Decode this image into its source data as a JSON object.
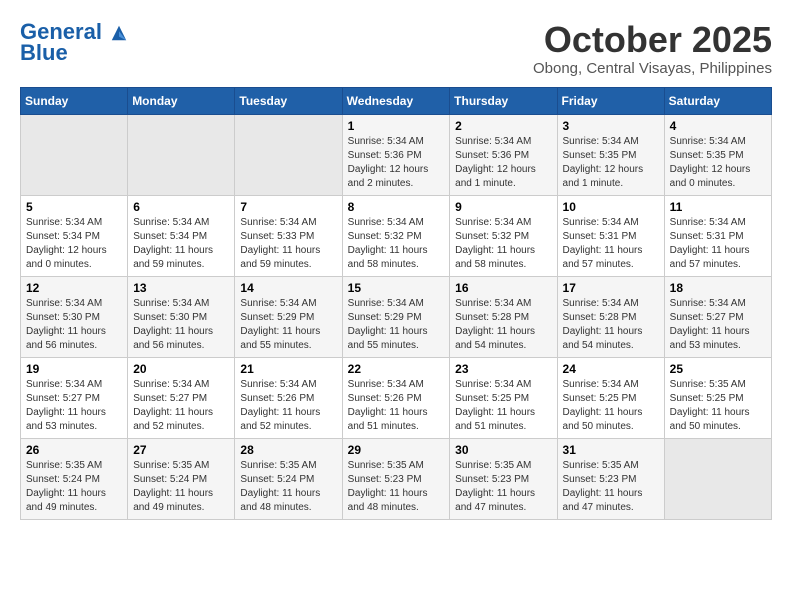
{
  "header": {
    "logo_line1": "General",
    "logo_line2": "Blue",
    "month": "October 2025",
    "location": "Obong, Central Visayas, Philippines"
  },
  "days_of_week": [
    "Sunday",
    "Monday",
    "Tuesday",
    "Wednesday",
    "Thursday",
    "Friday",
    "Saturday"
  ],
  "weeks": [
    [
      {
        "day": "",
        "info": ""
      },
      {
        "day": "",
        "info": ""
      },
      {
        "day": "",
        "info": ""
      },
      {
        "day": "1",
        "info": "Sunrise: 5:34 AM\nSunset: 5:36 PM\nDaylight: 12 hours\nand 2 minutes."
      },
      {
        "day": "2",
        "info": "Sunrise: 5:34 AM\nSunset: 5:36 PM\nDaylight: 12 hours\nand 1 minute."
      },
      {
        "day": "3",
        "info": "Sunrise: 5:34 AM\nSunset: 5:35 PM\nDaylight: 12 hours\nand 1 minute."
      },
      {
        "day": "4",
        "info": "Sunrise: 5:34 AM\nSunset: 5:35 PM\nDaylight: 12 hours\nand 0 minutes."
      }
    ],
    [
      {
        "day": "5",
        "info": "Sunrise: 5:34 AM\nSunset: 5:34 PM\nDaylight: 12 hours\nand 0 minutes."
      },
      {
        "day": "6",
        "info": "Sunrise: 5:34 AM\nSunset: 5:34 PM\nDaylight: 11 hours\nand 59 minutes."
      },
      {
        "day": "7",
        "info": "Sunrise: 5:34 AM\nSunset: 5:33 PM\nDaylight: 11 hours\nand 59 minutes."
      },
      {
        "day": "8",
        "info": "Sunrise: 5:34 AM\nSunset: 5:32 PM\nDaylight: 11 hours\nand 58 minutes."
      },
      {
        "day": "9",
        "info": "Sunrise: 5:34 AM\nSunset: 5:32 PM\nDaylight: 11 hours\nand 58 minutes."
      },
      {
        "day": "10",
        "info": "Sunrise: 5:34 AM\nSunset: 5:31 PM\nDaylight: 11 hours\nand 57 minutes."
      },
      {
        "day": "11",
        "info": "Sunrise: 5:34 AM\nSunset: 5:31 PM\nDaylight: 11 hours\nand 57 minutes."
      }
    ],
    [
      {
        "day": "12",
        "info": "Sunrise: 5:34 AM\nSunset: 5:30 PM\nDaylight: 11 hours\nand 56 minutes."
      },
      {
        "day": "13",
        "info": "Sunrise: 5:34 AM\nSunset: 5:30 PM\nDaylight: 11 hours\nand 56 minutes."
      },
      {
        "day": "14",
        "info": "Sunrise: 5:34 AM\nSunset: 5:29 PM\nDaylight: 11 hours\nand 55 minutes."
      },
      {
        "day": "15",
        "info": "Sunrise: 5:34 AM\nSunset: 5:29 PM\nDaylight: 11 hours\nand 55 minutes."
      },
      {
        "day": "16",
        "info": "Sunrise: 5:34 AM\nSunset: 5:28 PM\nDaylight: 11 hours\nand 54 minutes."
      },
      {
        "day": "17",
        "info": "Sunrise: 5:34 AM\nSunset: 5:28 PM\nDaylight: 11 hours\nand 54 minutes."
      },
      {
        "day": "18",
        "info": "Sunrise: 5:34 AM\nSunset: 5:27 PM\nDaylight: 11 hours\nand 53 minutes."
      }
    ],
    [
      {
        "day": "19",
        "info": "Sunrise: 5:34 AM\nSunset: 5:27 PM\nDaylight: 11 hours\nand 53 minutes."
      },
      {
        "day": "20",
        "info": "Sunrise: 5:34 AM\nSunset: 5:27 PM\nDaylight: 11 hours\nand 52 minutes."
      },
      {
        "day": "21",
        "info": "Sunrise: 5:34 AM\nSunset: 5:26 PM\nDaylight: 11 hours\nand 52 minutes."
      },
      {
        "day": "22",
        "info": "Sunrise: 5:34 AM\nSunset: 5:26 PM\nDaylight: 11 hours\nand 51 minutes."
      },
      {
        "day": "23",
        "info": "Sunrise: 5:34 AM\nSunset: 5:25 PM\nDaylight: 11 hours\nand 51 minutes."
      },
      {
        "day": "24",
        "info": "Sunrise: 5:34 AM\nSunset: 5:25 PM\nDaylight: 11 hours\nand 50 minutes."
      },
      {
        "day": "25",
        "info": "Sunrise: 5:35 AM\nSunset: 5:25 PM\nDaylight: 11 hours\nand 50 minutes."
      }
    ],
    [
      {
        "day": "26",
        "info": "Sunrise: 5:35 AM\nSunset: 5:24 PM\nDaylight: 11 hours\nand 49 minutes."
      },
      {
        "day": "27",
        "info": "Sunrise: 5:35 AM\nSunset: 5:24 PM\nDaylight: 11 hours\nand 49 minutes."
      },
      {
        "day": "28",
        "info": "Sunrise: 5:35 AM\nSunset: 5:24 PM\nDaylight: 11 hours\nand 48 minutes."
      },
      {
        "day": "29",
        "info": "Sunrise: 5:35 AM\nSunset: 5:23 PM\nDaylight: 11 hours\nand 48 minutes."
      },
      {
        "day": "30",
        "info": "Sunrise: 5:35 AM\nSunset: 5:23 PM\nDaylight: 11 hours\nand 47 minutes."
      },
      {
        "day": "31",
        "info": "Sunrise: 5:35 AM\nSunset: 5:23 PM\nDaylight: 11 hours\nand 47 minutes."
      },
      {
        "day": "",
        "info": ""
      }
    ]
  ]
}
